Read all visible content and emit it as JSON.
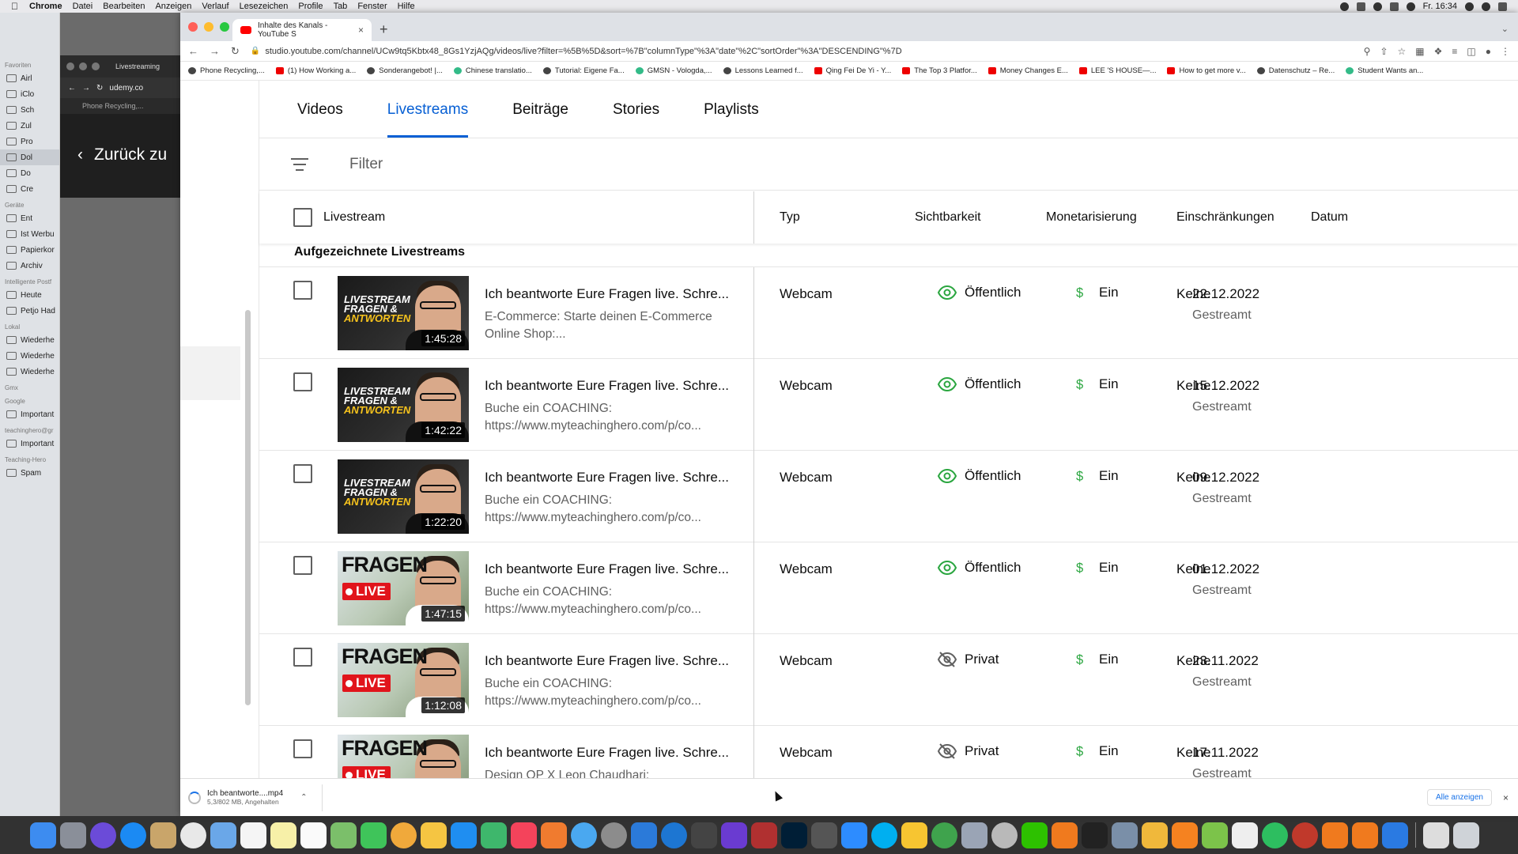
{
  "menubar": {
    "app": "Chrome",
    "items": [
      "Datei",
      "Bearbeiten",
      "Anzeigen",
      "Verlauf",
      "Lesezeichen",
      "Profile",
      "Tab",
      "Fenster",
      "Hilfe"
    ],
    "clock": "Fr. 16:34"
  },
  "mail_sidebar": {
    "favorites_label": "Favoriten",
    "favorites": [
      "Airl",
      "iClo",
      "Sch",
      "Zul",
      "Pro",
      "Dol",
      "Do",
      "Cre"
    ],
    "devices_label": "Geräte",
    "devices": [
      "Ent"
    ],
    "folders": [
      "Ist Werbu",
      "Papierkor",
      "Archiv"
    ],
    "smart_label": "Intelligente Postf",
    "smart": [
      "Heute",
      "Petjo Had"
    ],
    "local_label": "Lokal",
    "local": [
      "Wiederhe",
      "Wiederhe",
      "Wiederhe"
    ],
    "gmx_label": "Gmx",
    "google_label": "Google",
    "google": [
      "Important"
    ],
    "th_label": "teachinghero@gr",
    "th": [
      "Important"
    ],
    "teaching_label": "Teaching-Hero",
    "teaching": [
      "Spam"
    ]
  },
  "udemy_window": {
    "tab_title": "Livestreaming",
    "url": "udemy.co",
    "bookmark": "Phone Recycling,...",
    "back_label": "Zurück zu"
  },
  "chrome": {
    "tab_title": "Inhalte des Kanals - YouTube S",
    "url": "studio.youtube.com/channel/UCw9tq5Kbtx48_8Gs1YzjAQg/videos/live?filter=%5B%5D&sort=%7B\"columnType\"%3A\"date\"%2C\"sortOrder\"%3A\"DESCENDING\"%7D",
    "bookmarks": [
      "Phone Recycling,...",
      "(1) How Working a...",
      "Sonderangebot! |...",
      "Chinese translatio...",
      "Tutorial: Eigene Fa...",
      "GMSN - Vologda,...",
      "Lessons Learned f...",
      "Qing Fei De Yi - Y...",
      "The Top 3 Platfor...",
      "Money Changes E...",
      "LEE 'S HOUSE—...",
      "How to get more v...",
      "Datenschutz – Re...",
      "Student Wants an..."
    ]
  },
  "studio": {
    "tabs": [
      "Videos",
      "Livestreams",
      "Beiträge",
      "Stories",
      "Playlists"
    ],
    "active_tab": "Livestreams",
    "filter_placeholder": "Filter",
    "columns": {
      "livestream": "Livestream",
      "typ": "Typ",
      "sichtbarkeit": "Sichtbarkeit",
      "monetarisierung": "Monetarisierung",
      "einschraenkungen": "Einschränkungen",
      "datum": "Datum"
    },
    "section_label": "Aufgezeichnete Livestreams",
    "rows": [
      {
        "title": "Ich beantworte Eure Fragen live. Schre...",
        "desc1": "E-Commerce: Starte deinen E-Commerce",
        "desc2": "Online Shop:...",
        "duration": "1:45:28",
        "thumb_text": "LIVESTREAM FRAGEN & ANTWORTEN",
        "type": "Webcam",
        "visibility": "Öffentlich",
        "monetization": "Ein",
        "restrictions": "Keine",
        "date": "22.12.2022",
        "status": "Gestreamt"
      },
      {
        "title": "Ich beantworte Eure Fragen live. Schre...",
        "desc1": "Buche ein COACHING:",
        "desc2": "https://www.myteachinghero.com/p/co...",
        "duration": "1:42:22",
        "thumb_text": "LIVESTREAM FRAGEN & ANTWORTEN",
        "type": "Webcam",
        "visibility": "Öffentlich",
        "monetization": "Ein",
        "restrictions": "Keine",
        "date": "15.12.2022",
        "status": "Gestreamt"
      },
      {
        "title": "Ich beantworte Eure Fragen live. Schre...",
        "desc1": "Buche ein COACHING:",
        "desc2": "https://www.myteachinghero.com/p/co...",
        "duration": "1:22:20",
        "thumb_text": "LIVESTREAM FRAGEN & ANTWORTEN",
        "type": "Webcam",
        "visibility": "Öffentlich",
        "monetization": "Ein",
        "restrictions": "Keine",
        "date": "09.12.2022",
        "status": "Gestreamt"
      },
      {
        "title": "Ich beantworte Eure Fragen live. Schre...",
        "desc1": "Buche ein COACHING:",
        "desc2": "https://www.myteachinghero.com/p/co...",
        "duration": "1:47:15",
        "thumb_text": "FRAGEN",
        "thumb_live": "LIVE",
        "type": "Webcam",
        "visibility": "Öffentlich",
        "monetization": "Ein",
        "restrictions": "Keine",
        "date": "01.12.2022",
        "status": "Gestreamt"
      },
      {
        "title": "Ich beantworte Eure Fragen live. Schre...",
        "desc1": "Buche ein COACHING:",
        "desc2": "https://www.myteachinghero.com/p/co...",
        "duration": "1:12:08",
        "thumb_text": "FRAGEN",
        "thumb_live": "LIVE",
        "type": "Webcam",
        "visibility": "Privat",
        "monetization": "Ein",
        "restrictions": "Keine",
        "date": "23.11.2022",
        "status": "Gestreamt"
      },
      {
        "title": "Ich beantworte Eure Fragen live. Schre...",
        "desc1": "Design OP X Leon Chaudhari:",
        "desc2": "",
        "duration": "",
        "thumb_text": "FRAGEN",
        "thumb_live": "LIVE",
        "type": "Webcam",
        "visibility": "Privat",
        "monetization": "Ein",
        "restrictions": "Keine",
        "date": "17.11.2022",
        "status": "Gestreamt"
      }
    ]
  },
  "download": {
    "name": "Ich beantworte....mp4",
    "status": "5,3/802 MB, Angehalten",
    "show_all": "Alle anzeigen"
  },
  "colors": {
    "accent": "#065fd4",
    "public_icon": "#2ba640",
    "text_secondary": "#606060"
  }
}
